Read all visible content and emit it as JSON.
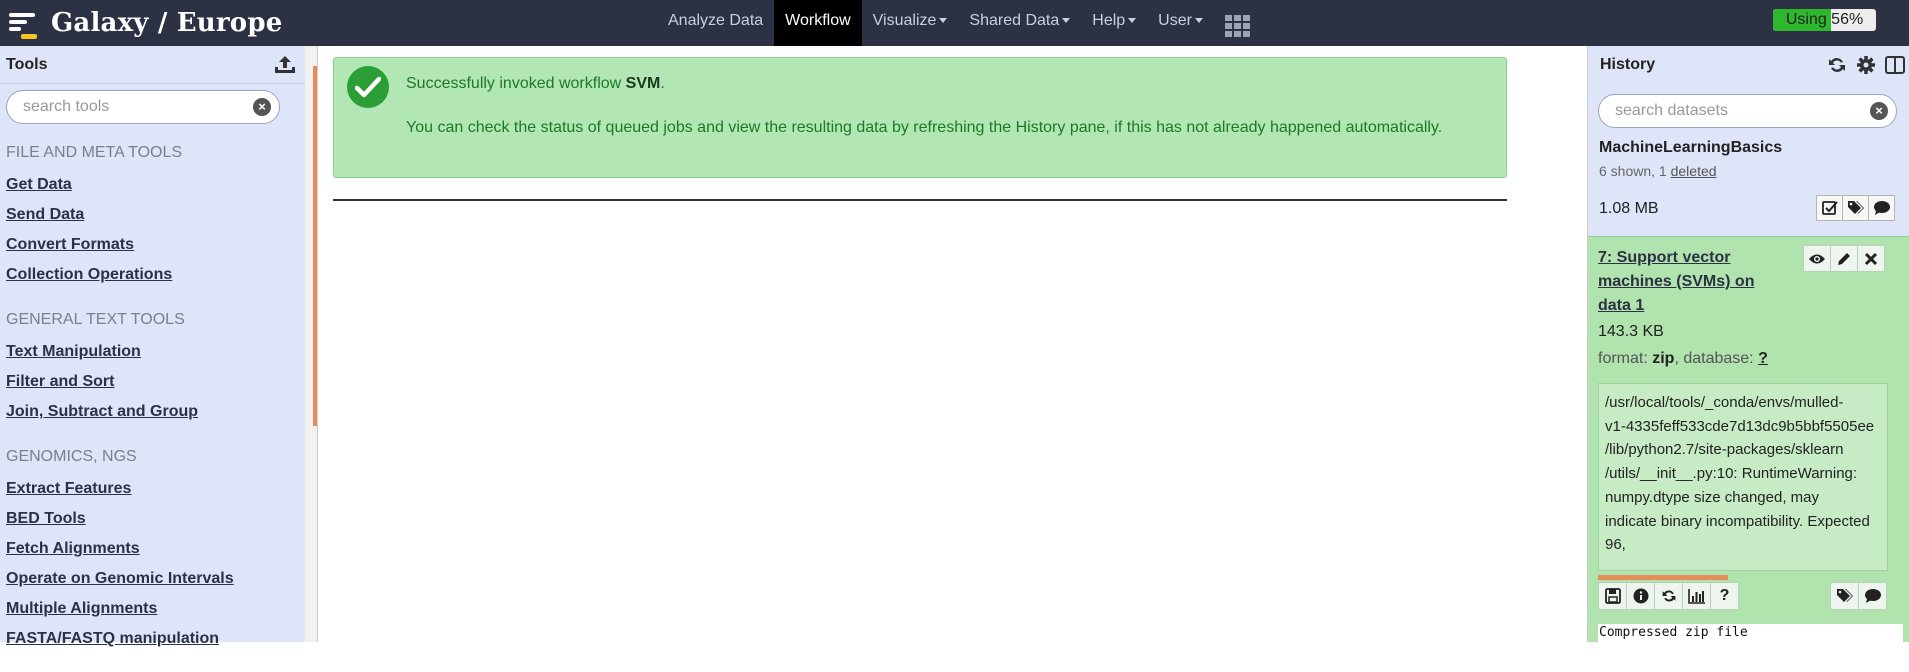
{
  "brand": {
    "title": "Galaxy / Europe"
  },
  "nav": {
    "items": [
      {
        "label": "Analyze Data",
        "dropdown": false,
        "active": false
      },
      {
        "label": "Workflow",
        "dropdown": false,
        "active": true
      },
      {
        "label": "Visualize",
        "dropdown": true,
        "active": false
      },
      {
        "label": "Shared Data",
        "dropdown": true,
        "active": false
      },
      {
        "label": "Help",
        "dropdown": true,
        "active": false
      },
      {
        "label": "User",
        "dropdown": true,
        "active": false
      }
    ],
    "apps_icon": "grid-icon"
  },
  "quota": {
    "label": "Using 56%",
    "percent": 56
  },
  "tools": {
    "title": "Tools",
    "upload_icon": "upload-icon",
    "search_placeholder": "search tools",
    "sections": [
      {
        "title": "FILE AND META TOOLS",
        "links": [
          "Get Data",
          "Send Data",
          "Convert Formats",
          "Collection Operations"
        ]
      },
      {
        "title": "GENERAL TEXT TOOLS",
        "links": [
          "Text Manipulation",
          "Filter and Sort",
          "Join, Subtract and Group"
        ]
      },
      {
        "title": "GENOMICS, NGS",
        "links": [
          "Extract Features",
          "BED Tools",
          "Fetch Alignments",
          "Operate on Genomic Intervals",
          "Multiple Alignments",
          "FASTA/FASTQ manipulation"
        ]
      }
    ]
  },
  "message": {
    "line1_prefix": "Successfully invoked workflow ",
    "workflow_name": "SVM",
    "line1_suffix": ".",
    "line2": "You can check the status of queued jobs and view the resulting data by refreshing the History pane, if this has not already happened automatically."
  },
  "history": {
    "title": "History",
    "search_placeholder": "search datasets",
    "name": "MachineLearningBasics",
    "shown": "6 shown, 1 ",
    "deleted_link": "deleted",
    "size": "1.08 MB",
    "dataset": {
      "title": "7: Support vector machines (SVMs) on data 1",
      "size": "143.3 KB",
      "format_label": "format: ",
      "format": "zip",
      "database_label": ", database: ",
      "database": "?",
      "info": "/usr/local/tools/_conda/envs/mulled-\nv1-4335feff533cde7d13dc9b5bbf5505ee\n/lib/python2.7/site-packages/sklearn\n/utils/__init__.py:10: RuntimeWarning:\nnumpy.dtype size changed, may\nindicate binary incompatibility. Expected\n96,",
      "peek": "Compressed zip file"
    }
  },
  "colors": {
    "masthead": "#2c3143",
    "panel": "#dfe5f9",
    "success_bg": "#b3e6b5",
    "dataset_ok": "#b0e3ad",
    "quota": "#2eb82e"
  }
}
